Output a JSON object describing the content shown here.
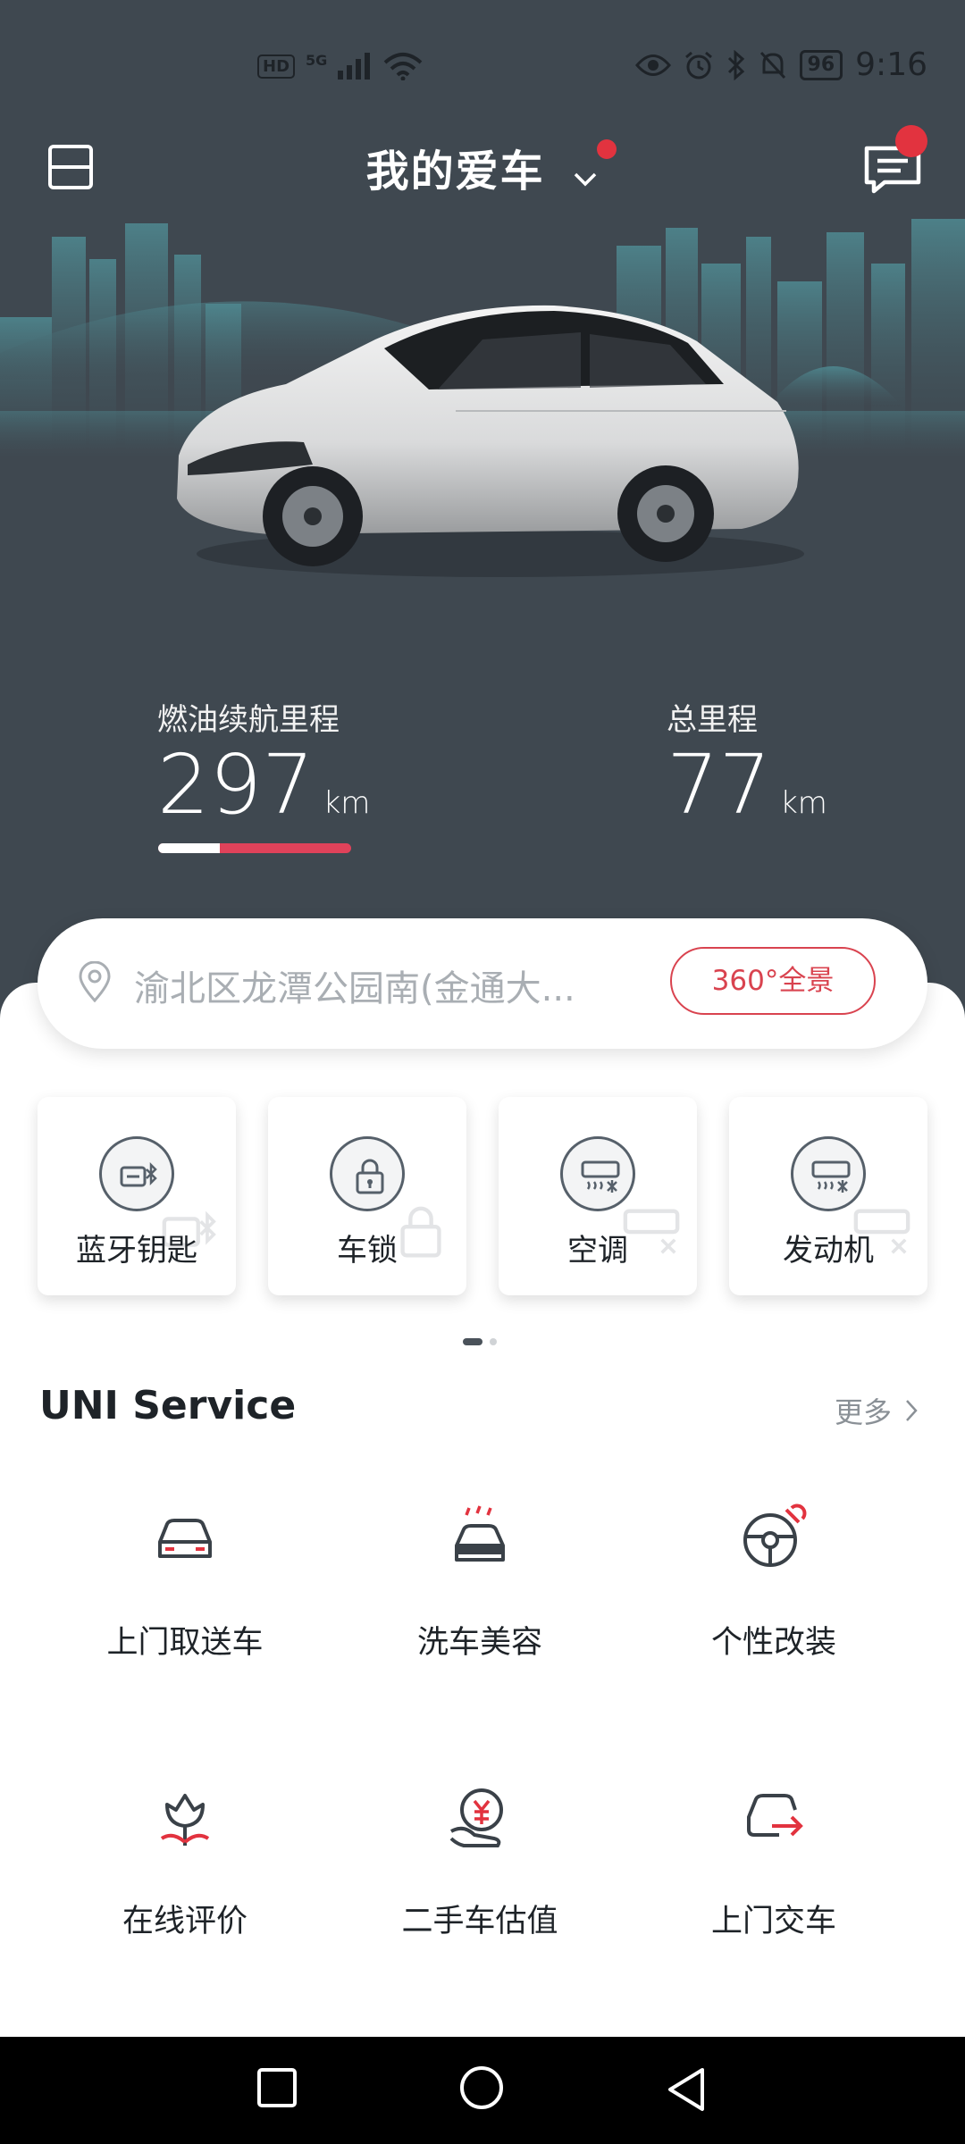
{
  "status_bar": {
    "network_badge": "HD",
    "network_type": "5G",
    "battery": "96",
    "time": "9:16"
  },
  "header": {
    "title": "我的爱车"
  },
  "stats": {
    "range_label": "燃油续航里程",
    "range_value": "297",
    "range_unit": "km",
    "range_fill_fraction": 0.32,
    "total_label": "总里程",
    "total_value": "77",
    "total_unit": "km"
  },
  "location": {
    "address": "渝北区龙潭公园南(金通大...",
    "panorama_button": "360°全景"
  },
  "controls": [
    {
      "label": "蓝牙钥匙",
      "icon": "bluetooth-key-icon"
    },
    {
      "label": "车锁",
      "icon": "lock-icon"
    },
    {
      "label": "空调",
      "icon": "air-conditioner-icon"
    },
    {
      "label": "发动机",
      "icon": "engine-icon"
    }
  ],
  "services": {
    "title": "UNI Service",
    "more": "更多",
    "items": [
      {
        "label": "上门取送车",
        "icon": "car-pickup-icon"
      },
      {
        "label": "洗车美容",
        "icon": "car-wash-icon"
      },
      {
        "label": "个性改装",
        "icon": "steering-wrench-icon"
      },
      {
        "label": "在线评价",
        "icon": "flower-review-icon"
      },
      {
        "label": "二手车估值",
        "icon": "yuan-hand-icon"
      },
      {
        "label": "上门交车",
        "icon": "car-delivery-icon"
      }
    ]
  },
  "colors": {
    "background": "#3f4850",
    "accent": "#e2333f",
    "range_bar": "#e0425a"
  }
}
